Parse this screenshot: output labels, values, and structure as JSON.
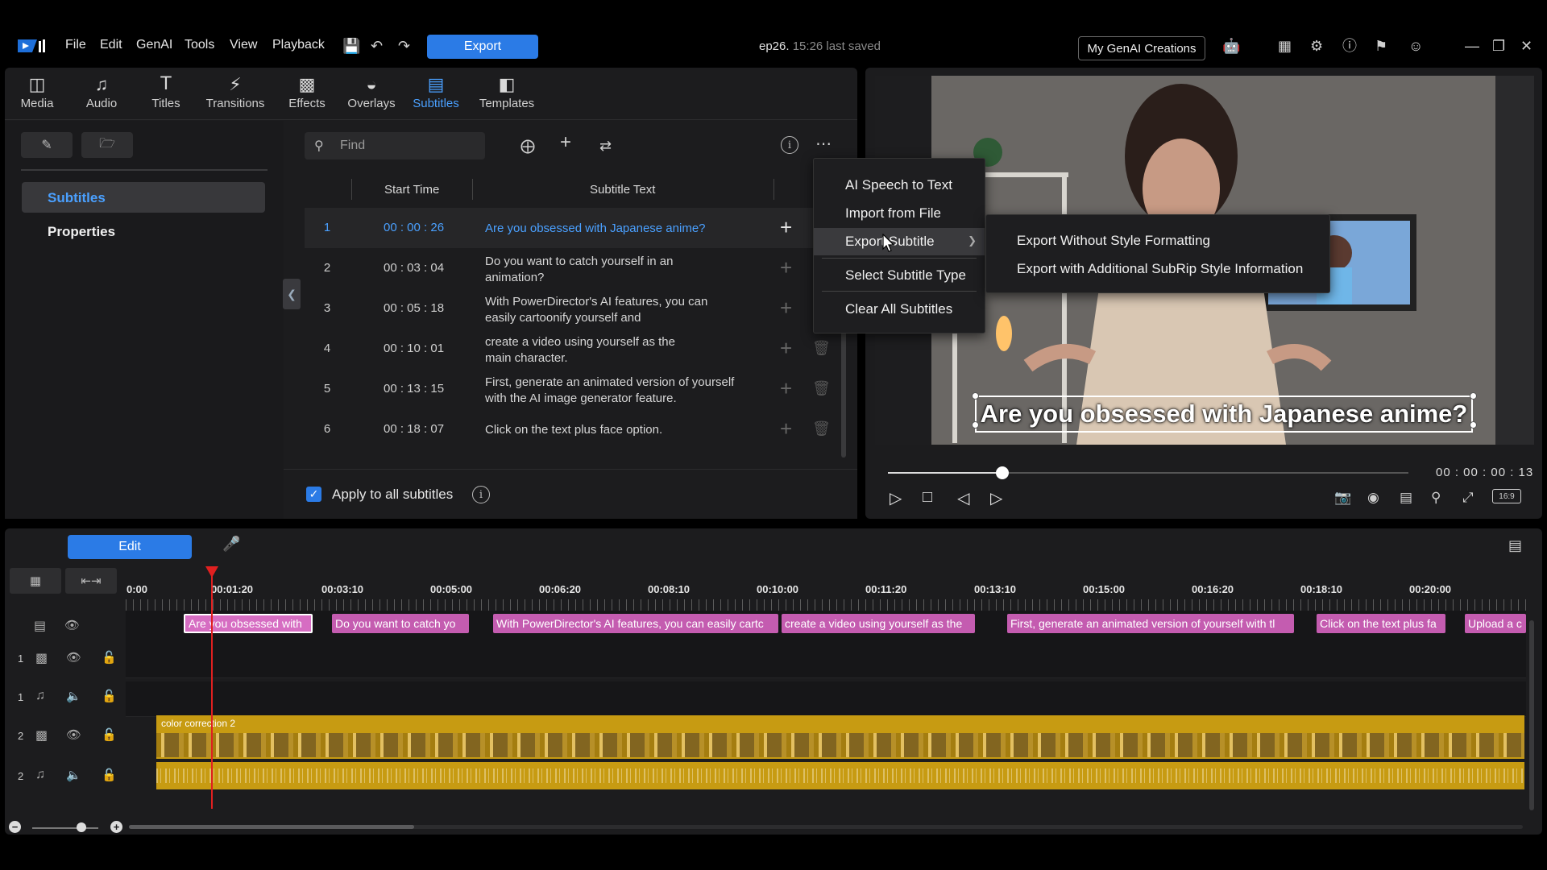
{
  "menu": {
    "items": [
      "File",
      "Edit",
      "GenAI",
      "Tools",
      "View",
      "Playback"
    ],
    "export_label": "Export",
    "project_name": "ep26.",
    "saved_status": "15:26 last saved",
    "genai_label": "My GenAI Creations"
  },
  "tabs": [
    {
      "label": "Media",
      "icon": "media-icon"
    },
    {
      "label": "Audio",
      "icon": "music-note-icon"
    },
    {
      "label": "Titles",
      "icon": "title-t-icon"
    },
    {
      "label": "Transitions",
      "icon": "transition-icon"
    },
    {
      "label": "Effects",
      "icon": "effects-icon"
    },
    {
      "label": "Overlays",
      "icon": "overlay-icon"
    },
    {
      "label": "Subtitles",
      "icon": "subtitle-icon"
    },
    {
      "label": "Templates",
      "icon": "template-icon"
    }
  ],
  "active_tab": "Subtitles",
  "sidebar": {
    "items": [
      "Subtitles",
      "Properties"
    ]
  },
  "search": {
    "placeholder": "Find"
  },
  "table": {
    "columns": [
      "Start Time",
      "Subtitle Text"
    ],
    "rows": [
      {
        "num": "1",
        "time": "00 : 00 : 26",
        "text": "Are you obsessed with Japanese anime?"
      },
      {
        "num": "2",
        "time": "00 : 03 : 04",
        "text": "Do you want to catch yourself in an animation?"
      },
      {
        "num": "3",
        "time": "00 : 05 : 18",
        "text": "With PowerDirector's AI features, you can easily cartoonify yourself and"
      },
      {
        "num": "4",
        "time": "00 : 10 : 01",
        "text": "create a video using yourself as the main character."
      },
      {
        "num": "5",
        "time": "00 : 13 : 15",
        "text": "First, generate an animated version of yourself with the AI image generator feature."
      },
      {
        "num": "6",
        "time": "00 : 18 : 07",
        "text": "Click on the text plus face option."
      }
    ]
  },
  "apply_all_label": "Apply to all subtitles",
  "context_menu": {
    "items": [
      "AI Speech to Text",
      "Import from File",
      "Export Subtitle",
      "Select Subtitle Type",
      "Clear All Subtitles"
    ],
    "submenu": [
      "Export Without Style Formatting",
      "Export with Additional SubRip Style Information"
    ]
  },
  "preview": {
    "caption": "Are you obsessed with Japanese anime?",
    "timecode": "00 : 00 : 00 : 13",
    "aspect": "16:9",
    "progress_fraction": 0.22
  },
  "timeline": {
    "edit_label": "Edit",
    "ruler": [
      "0:00",
      "00:01:20",
      "00:03:10",
      "00:05:00",
      "00:06:20",
      "00:08:10",
      "00:10:00",
      "00:11:20",
      "00:13:10",
      "00:15:00",
      "00:16:20",
      "00:18:10",
      "00:20:00"
    ],
    "subtitle_clips": [
      "Are you obsessed with",
      "Do you want to catch yo",
      "With PowerDirector's AI features, you can easily cartc",
      "create a video using yourself as the",
      "First, generate an animated version of yourself with tl",
      "Click on the text plus fa",
      "Upload a c"
    ],
    "tracks": [
      {
        "num": "1",
        "kind": "video"
      },
      {
        "num": "1",
        "kind": "audio"
      },
      {
        "num": "2",
        "kind": "video"
      },
      {
        "num": "2",
        "kind": "audio"
      }
    ],
    "video_clip_label": "color correction 2"
  },
  "colors": {
    "accent": "#2b7be6",
    "selected_text": "#4aa0ff",
    "subtitle_clip": "#c45cb0",
    "video_clip": "#c79b12",
    "playhead": "#e02020"
  }
}
